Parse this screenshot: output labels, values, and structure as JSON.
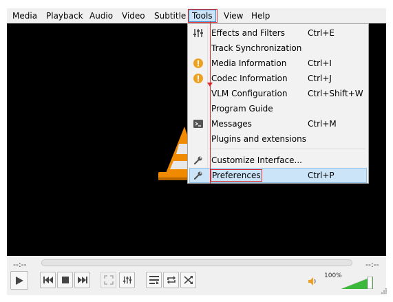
{
  "menubar": {
    "items": [
      {
        "label": "Media"
      },
      {
        "label": "Playback"
      },
      {
        "label": "Audio"
      },
      {
        "label": "Video"
      },
      {
        "label": "Subtitle"
      },
      {
        "label": "Tools"
      },
      {
        "label": "View"
      },
      {
        "label": "Help"
      }
    ],
    "active": "Tools"
  },
  "tools_menu": {
    "items": [
      {
        "label": "Effects and Filters",
        "shortcut": "Ctrl+E",
        "icon": "equalizer-icon"
      },
      {
        "label": "Track Synchronization",
        "shortcut": "",
        "icon": ""
      },
      {
        "label": "Media Information",
        "shortcut": "Ctrl+I",
        "icon": "info-icon"
      },
      {
        "label": "Codec Information",
        "shortcut": "Ctrl+J",
        "icon": "info-icon"
      },
      {
        "label": "VLM Configuration",
        "shortcut": "Ctrl+Shift+W",
        "icon": ""
      },
      {
        "label": "Program Guide",
        "shortcut": "",
        "icon": ""
      },
      {
        "label": "Messages",
        "shortcut": "Ctrl+M",
        "icon": "terminal-icon"
      },
      {
        "label": "Plugins and extensions",
        "shortcut": "",
        "icon": ""
      },
      {
        "label": "Customize Interface...",
        "shortcut": "",
        "icon": "wrench-icon"
      },
      {
        "label": "Preferences",
        "shortcut": "Ctrl+P",
        "icon": "wrench-icon"
      }
    ],
    "highlighted": "Preferences"
  },
  "controls": {
    "elapsed": "--:--",
    "remaining": "--:--",
    "volume_text": "100%",
    "volume_level": 1.0
  },
  "colors": {
    "accent_highlight": "#cce4f7",
    "annotation_red": "#d7282c",
    "vlc_orange": "#f08a00",
    "info_orange": "#f0a020",
    "volume_green": "#3cb83c"
  }
}
